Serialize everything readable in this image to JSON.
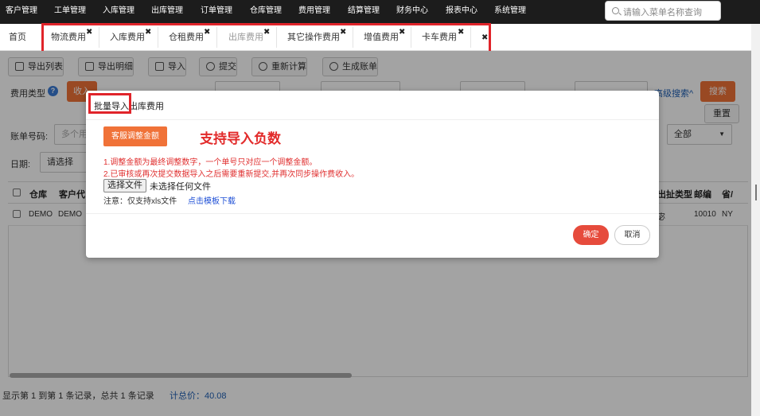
{
  "topnav": {
    "items": [
      "客户管理",
      "工单管理",
      "入库管理",
      "出库管理",
      "订单管理",
      "仓库管理",
      "费用管理",
      "结算管理",
      "财务中心",
      "报表中心",
      "系统管理"
    ],
    "search_placeholder": "请输入菜单名称查询"
  },
  "tabs": {
    "home": "首页",
    "items": [
      "物流费用",
      "入库费用",
      "仓租费用",
      "出库费用",
      "其它操作费用",
      "增值费用",
      "卡车费用"
    ],
    "active": "出库费用"
  },
  "toolbar": [
    "导出列表",
    "导出明细",
    "导入",
    "提交",
    "重新计算",
    "生成账单"
  ],
  "filters": {
    "fee_type_label": "费用类型",
    "fee_type_btn": "收入",
    "advanced_link": "高级搜索^",
    "search_btn": "搜索",
    "reset_btn": "重置",
    "bill_no_label": "账单号码:",
    "bill_no_placeholder": "多个用",
    "date_label": "日期:",
    "date_placeholder": "请选择",
    "select_all": "全部"
  },
  "grid": {
    "headers_left": [
      "仓库",
      "客户代"
    ],
    "headers_right": [
      "出扯类型",
      "邮编",
      "省/"
    ],
    "row_left": [
      "DEMO",
      "DEMO"
    ],
    "row_right": [
      "宓",
      "10010",
      "NY"
    ]
  },
  "footer": {
    "records": "显示第 1 到第 1 条记录，总共 1 条记录",
    "total": "计总价：40.08"
  },
  "modal": {
    "title_a": "批量导入",
    "title_b": "出库费用",
    "adjust_btn": "客服调整金额",
    "annotation": "支持导入负数",
    "note1": "1.调整金额为最终调整数字，一个单号只对应一个调整金额。",
    "note2": "2.已审核或再次提交数据导入之后需要重新提交,并再次同步操作费收入。",
    "file_btn": "选择文件",
    "file_status": "未选择任何文件",
    "hint": "注意：仅支持xls文件",
    "template_link": "点击模板下载",
    "ok": "确定",
    "cancel": "取消"
  }
}
